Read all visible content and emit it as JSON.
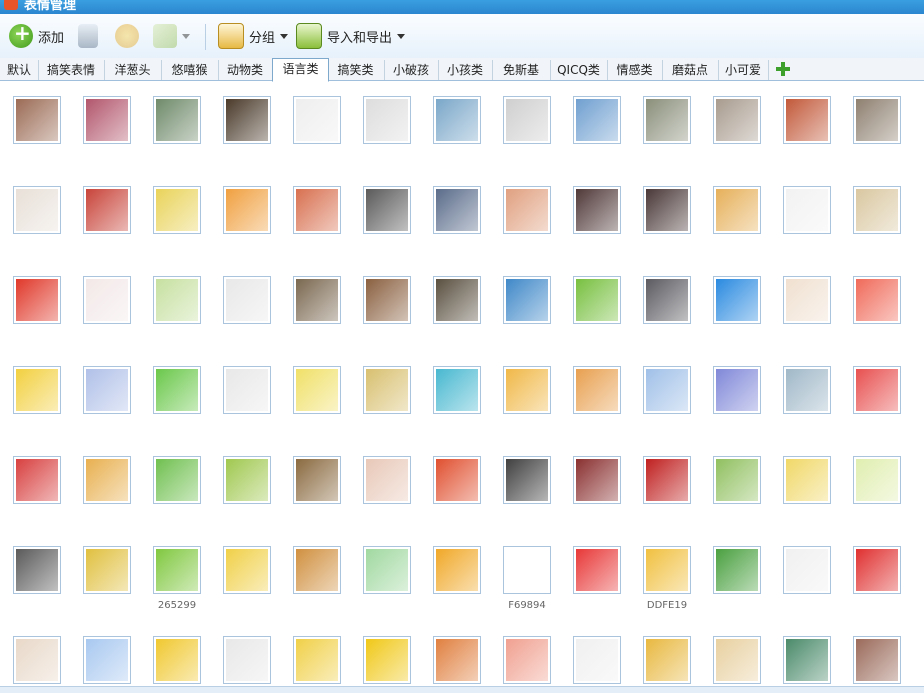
{
  "window": {
    "title": "表情管理"
  },
  "toolbar": {
    "add_label": "添加",
    "group_label": "分组",
    "import_export_label": "导入和导出"
  },
  "tabs": [
    "默认",
    "搞笑表情",
    "洋葱头",
    "悠嘻猴",
    "动物类",
    "语言类",
    "搞笑类",
    "小破孩",
    "小孩类",
    "免斯基",
    "QICQ类",
    "情感类",
    "磨菇点",
    "小可爱"
  ],
  "active_tab": "语言类",
  "emoji_rows": [
    [
      "#9b6b55",
      "#b2566c",
      "#6f8a6a",
      "#4a3a2a",
      "#eeeeee",
      "#dddddd",
      "#7aa7c9",
      "#cfcfcf",
      "#6f9fd0",
      "#8a8f7a",
      "#a89b8e",
      "#c2593a",
      "#8e8070"
    ],
    [
      "#e8e0d8",
      "#c8443a",
      "#e9d35a",
      "#f0a040",
      "#d87050",
      "#5a5a5a",
      "#5a6c8a",
      "#e0a080",
      "#503838",
      "#4a3838",
      "#e6b05a",
      "#f2f2f2",
      "#d9c7a0"
    ],
    [
      "#e0382a",
      "#f3e8e8",
      "#c6e0a0",
      "#e8e8e8",
      "#7a6850",
      "#8a6040",
      "#5a5040",
      "#3f88c8",
      "#78c040",
      "#5a5a60",
      "#2a8ae0",
      "#f0e0d0",
      "#f06a5a"
    ],
    [
      "#f2d040",
      "#b0c0e8",
      "#6ac84a",
      "#e8e8e8",
      "#f0e068",
      "#d8c070",
      "#48b8d0",
      "#f0b848",
      "#e8a050",
      "#a0c0e8",
      "#8088d8",
      "#a0b8c8",
      "#e85050"
    ],
    [
      "#d84040",
      "#e8b050",
      "#70c050",
      "#a0c850",
      "#8a6a40",
      "#e8c8b8",
      "#e05030",
      "#404040",
      "#8a3030",
      "#c02020",
      "#90c060",
      "#f0d868",
      "#e0eeb0"
    ],
    [
      "#5a5a5a",
      "#e0c040",
      "#80c840",
      "#f0d048",
      "#d09040",
      "#a0d8a0",
      "#f0a828",
      "#ffffff",
      "#e83838",
      "#f0c040",
      "#4aa040",
      "#f0f0f0",
      "#e03030"
    ],
    [
      "#e8d8c8",
      "#a8c8f0",
      "#f0c830",
      "#e8e8e8",
      "#f0d048",
      "#f0c818",
      "#e08040",
      "#f0a090",
      "#f0f0f0",
      "#e8b840",
      "#e8d0a0",
      "#4a8a6a",
      "#9a6a5a"
    ]
  ],
  "captions": [
    {
      "row": 5,
      "col": 2,
      "text": "265299"
    },
    {
      "row": 5,
      "col": 7,
      "text": "F69894"
    },
    {
      "row": 5,
      "col": 9,
      "text": "DDFE19"
    }
  ]
}
